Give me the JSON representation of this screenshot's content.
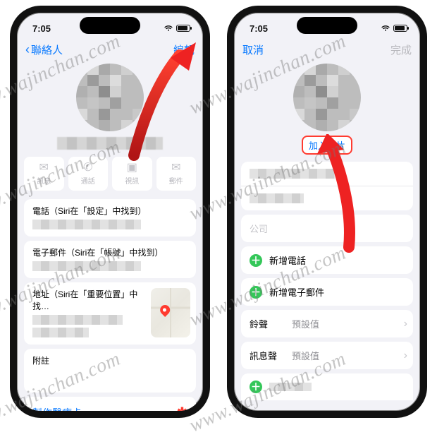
{
  "status": {
    "time": "7:05"
  },
  "view": {
    "nav_back": "聯絡人",
    "nav_edit": "編輯",
    "actions": {
      "message": "訊息",
      "call": "通話",
      "video": "視訊",
      "mail": "郵件"
    },
    "phone_label": "電話（Siri在「設定」中找到）",
    "email_label": "電子郵件（Siri在「帳號」中找到）",
    "address_label": "地址（Siri在「重要位置」中找…",
    "notes_label": "附註",
    "medical_card": "製作醫療卡"
  },
  "edit": {
    "nav_cancel": "取消",
    "nav_done": "完成",
    "add_photo": "加入照片",
    "company_placeholder": "公司",
    "add_phone": "新增電話",
    "add_email": "新增電子郵件",
    "ringtone_label": "鈴聲",
    "ringtone_value": "預設值",
    "texttone_label": "訊息聲",
    "texttone_value": "預設值"
  },
  "watermark": "www.wajinchan.com"
}
